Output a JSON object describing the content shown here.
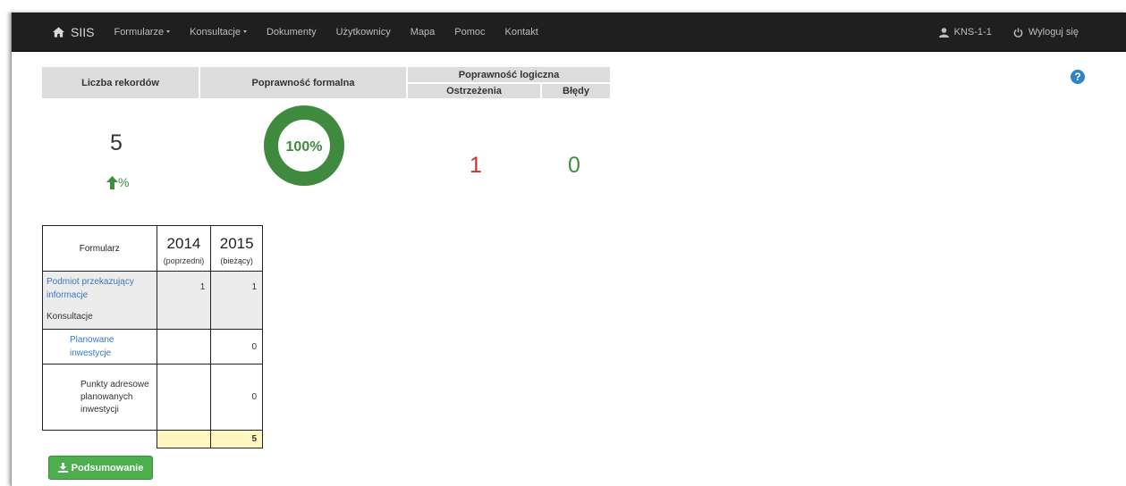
{
  "nav": {
    "brand": "SIIS",
    "items": [
      {
        "label": "Formularze",
        "dropdown": true
      },
      {
        "label": "Konsultacje",
        "dropdown": true
      },
      {
        "label": "Dokumenty",
        "dropdown": false
      },
      {
        "label": "Użytkownicy",
        "dropdown": false
      },
      {
        "label": "Mapa",
        "dropdown": false
      },
      {
        "label": "Pomoc",
        "dropdown": false
      },
      {
        "label": "Kontakt",
        "dropdown": false
      }
    ],
    "user": "KNS-1-1",
    "logout": "Wyloguj się"
  },
  "help": "?",
  "stats": {
    "records_header": "Liczba rekordów",
    "formal_header": "Poprawność formalna",
    "logic_header": "Poprawność logiczna",
    "warnings_header": "Ostrzeżenia",
    "errors_header": "Błędy",
    "record_count": "5",
    "trend": "%",
    "formal_percent": "100%",
    "formal_fraction": 1.0,
    "warnings": "1",
    "errors": "0"
  },
  "forms_table": {
    "header": "Formularz",
    "year_prev": "2014",
    "year_prev_sub": "(poprzedni)",
    "year_cur": "2015",
    "year_cur_sub": "(bieżący)",
    "rows": [
      {
        "label": "Podmiot przekazujący informacje",
        "sub_label": "Konsultacje",
        "prev": "1",
        "cur": "1"
      },
      {
        "label": "Planowane inwestycje",
        "prev": "",
        "cur": "0"
      },
      {
        "label": "Punkty adresowe planowanych inwestycji",
        "prev": "",
        "cur": "0"
      }
    ],
    "total_prev": "",
    "total_cur": "5"
  },
  "summary_button": "Podsumowanie",
  "colors": {
    "navbar": "#1f1f1f",
    "success": "#4cae4c",
    "danger": "#c9302c",
    "link": "#3a78c0",
    "highlight": "#fff6c0"
  }
}
